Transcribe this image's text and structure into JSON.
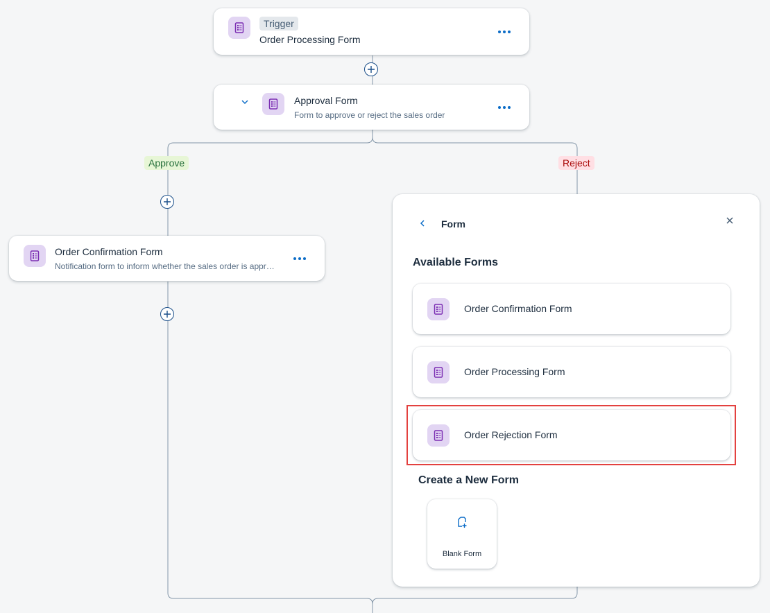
{
  "flow": {
    "trigger": {
      "tag": "Trigger",
      "title": "Order Processing Form",
      "icon": "form-icon"
    },
    "approval": {
      "title": "Approval Form",
      "subtitle": "Form to approve or reject the sales order",
      "icon": "form-icon"
    },
    "branches": {
      "approve_label": "Approve",
      "reject_label": "Reject"
    },
    "confirmation": {
      "title": "Order Confirmation Form",
      "subtitle": "Notification form to inform whether the sales order is appr…",
      "icon": "form-icon"
    }
  },
  "panel": {
    "title": "Form",
    "available_heading": "Available Forms",
    "forms": [
      {
        "label": "Order Confirmation Form"
      },
      {
        "label": "Order Processing Form"
      },
      {
        "label": "Order Rejection Form"
      }
    ],
    "create_heading": "Create a New Form",
    "blank_form_label": "Blank Form"
  },
  "colors": {
    "accent": "#0b6cc7",
    "approve_bg": "#e7f6d6",
    "approve_text": "#256f3a",
    "reject_bg": "#ffdfe4",
    "reject_text": "#aa0808",
    "highlight": "#e3413f",
    "form_icon_bg": "#e2d5f3",
    "form_icon_fg": "#7c2fb3"
  }
}
